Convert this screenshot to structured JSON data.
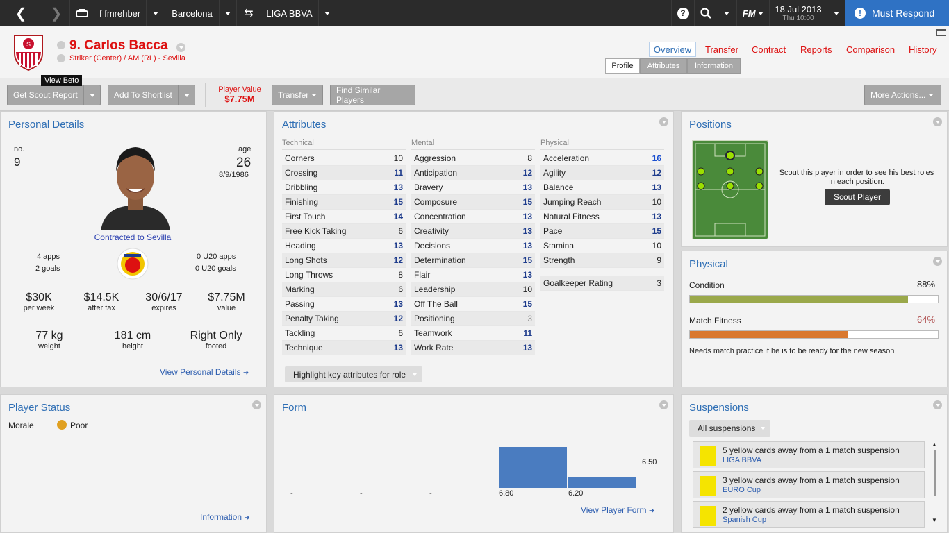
{
  "topbar": {
    "manager": "f fmrehber",
    "club": "Barcelona",
    "league": "LIGA BBVA",
    "fm_label": "FM",
    "date": "18 Jul 2013",
    "time": "Thu 10:00",
    "must_respond": "Must Respond"
  },
  "player": {
    "name": "9. Carlos Bacca",
    "position": "Striker (Center) / AM (RL) - Sevilla"
  },
  "tooltip": "View Beto",
  "nav_tabs": [
    "Overview",
    "Transfer",
    "Contract",
    "Reports",
    "Comparison",
    "History"
  ],
  "sub_tabs": [
    "Profile",
    "Attributes",
    "Information"
  ],
  "toolbar": {
    "scout_report": "Get Scout Report",
    "shortlist": "Add To Shortlist",
    "player_value_label": "Player Value",
    "player_value": "$7.75M",
    "transfer": "Transfer",
    "find_similar": "Find Similar Players",
    "more_actions": "More Actions..."
  },
  "personal": {
    "title": "Personal Details",
    "no_label": "no.",
    "no": "9",
    "age_label": "age",
    "age": "26",
    "dob": "8/9/1986",
    "contract": "Contracted to Sevilla",
    "apps": "4 apps",
    "goals": "2 goals",
    "u20_apps": "0 U20 apps",
    "u20_goals": "0 U20 goals",
    "wage": "$30K",
    "wage_label": "per week",
    "after_tax": "$14.5K",
    "after_tax_label": "after tax",
    "expires": "30/6/17",
    "expires_label": "expires",
    "value": "$7.75M",
    "value_label": "value",
    "weight": "77 kg",
    "weight_label": "weight",
    "height": "181 cm",
    "height_label": "height",
    "footed": "Right Only",
    "footed_label": "footed",
    "link": "View Personal Details"
  },
  "attributes": {
    "title": "Attributes",
    "technical_label": "Technical",
    "mental_label": "Mental",
    "physical_label": "Physical",
    "technical": [
      {
        "name": "Corners",
        "value": 10
      },
      {
        "name": "Crossing",
        "value": 11
      },
      {
        "name": "Dribbling",
        "value": 13
      },
      {
        "name": "Finishing",
        "value": 15
      },
      {
        "name": "First Touch",
        "value": 14
      },
      {
        "name": "Free Kick Taking",
        "value": 6
      },
      {
        "name": "Heading",
        "value": 13
      },
      {
        "name": "Long Shots",
        "value": 12
      },
      {
        "name": "Long Throws",
        "value": 8
      },
      {
        "name": "Marking",
        "value": 6
      },
      {
        "name": "Passing",
        "value": 13
      },
      {
        "name": "Penalty Taking",
        "value": 12
      },
      {
        "name": "Tackling",
        "value": 6
      },
      {
        "name": "Technique",
        "value": 13
      }
    ],
    "mental": [
      {
        "name": "Aggression",
        "value": 8
      },
      {
        "name": "Anticipation",
        "value": 12
      },
      {
        "name": "Bravery",
        "value": 13
      },
      {
        "name": "Composure",
        "value": 15
      },
      {
        "name": "Concentration",
        "value": 13
      },
      {
        "name": "Creativity",
        "value": 13
      },
      {
        "name": "Decisions",
        "value": 13
      },
      {
        "name": "Determination",
        "value": 15
      },
      {
        "name": "Flair",
        "value": 13
      },
      {
        "name": "Leadership",
        "value": 10
      },
      {
        "name": "Off The Ball",
        "value": 15
      },
      {
        "name": "Positioning",
        "value": 3
      },
      {
        "name": "Teamwork",
        "value": 11
      },
      {
        "name": "Work Rate",
        "value": 13
      }
    ],
    "physical": [
      {
        "name": "Acceleration",
        "value": 16
      },
      {
        "name": "Agility",
        "value": 12
      },
      {
        "name": "Balance",
        "value": 13
      },
      {
        "name": "Jumping Reach",
        "value": 10
      },
      {
        "name": "Natural Fitness",
        "value": 13
      },
      {
        "name": "Pace",
        "value": 15
      },
      {
        "name": "Stamina",
        "value": 10
      },
      {
        "name": "Strength",
        "value": 9
      }
    ],
    "gk_label": "Goalkeeper Rating",
    "gk_value": 3,
    "highlight_button": "Highlight key attributes for role"
  },
  "positions": {
    "title": "Positions",
    "text": "Scout this player in order to see his best roles in each position.",
    "button": "Scout Player"
  },
  "physical": {
    "title": "Physical",
    "condition_label": "Condition",
    "condition": "88%",
    "condition_value": 88,
    "fitness_label": "Match Fitness",
    "fitness": "64%",
    "fitness_value": 64,
    "note": "Needs match practice if he is to be ready for the new season",
    "colors": {
      "condition": "#9aa84a",
      "fitness": "#d9782f"
    }
  },
  "status": {
    "title": "Player Status",
    "morale_label": "Morale",
    "morale": "Poor",
    "link": "Information"
  },
  "form": {
    "title": "Form",
    "labels": [
      "-",
      "-",
      "-",
      "6.80",
      "6.20"
    ],
    "bar_values": [
      6.8,
      6.2
    ],
    "avg": "6.50",
    "link": "View Player Form"
  },
  "suspensions": {
    "title": "Suspensions",
    "filter": "All suspensions",
    "items": [
      {
        "text": "5 yellow cards away from a 1 match suspension",
        "comp": "LIGA BBVA"
      },
      {
        "text": "3 yellow cards away from a 1 match suspension",
        "comp": "EURO Cup"
      },
      {
        "text": "2 yellow cards away from a 1 match suspension",
        "comp": "Spanish Cup"
      }
    ]
  }
}
